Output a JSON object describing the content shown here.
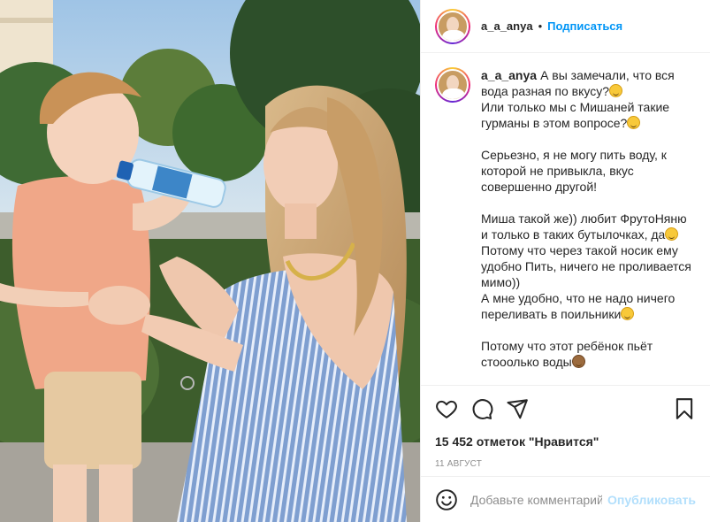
{
  "post": {
    "username": "a_a_anya",
    "separator": "•",
    "follow_label": "Подписаться",
    "caption": {
      "username": "a_a_anya",
      "lines": [
        "А вы замечали, что вся вода разная по вкусу?",
        "Или только мы с Мишаней такие гурманы в этом вопросе?",
        "",
        "Серьезно, я не могу пить воду, к которой не привыкла, вкус совершенно другой!",
        "",
        "Миша такой же)) любит ФрутоНяню и только в таких бутылочках, да",
        "Потому что через такой носик ему удобно Пить, ничего не проливается мимо))",
        "А мне удобно, что не надо ничего переливать в поильники",
        "",
        "Потому что этот ребёнок пьёт стооолько воды"
      ]
    },
    "likes_label": "15 452 отметок \"Нравится\"",
    "date": "11 АВГУСТ",
    "comment": {
      "placeholder": "Добавьте комментарий...",
      "publish_label": "Опубликовать"
    },
    "icons": {
      "like": "heart-icon",
      "comment": "comment-icon",
      "share": "share-icon",
      "save": "bookmark-icon",
      "emoji": "smiley-icon"
    },
    "colors": {
      "link": "#0095f6",
      "publish_disabled": "#b2dffc",
      "muted": "#8e8e8e",
      "text": "#262626"
    }
  }
}
